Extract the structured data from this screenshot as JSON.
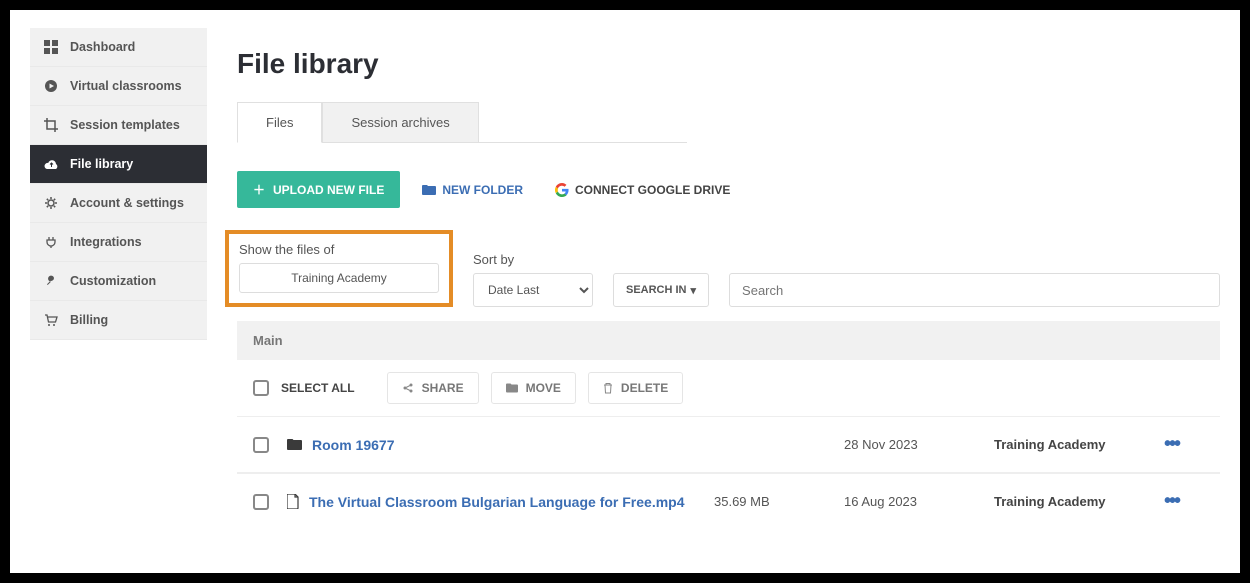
{
  "sidebar": {
    "items": [
      {
        "label": "Dashboard",
        "icon": "grid-icon"
      },
      {
        "label": "Virtual classrooms",
        "icon": "play-circle-icon"
      },
      {
        "label": "Session templates",
        "icon": "crop-icon"
      },
      {
        "label": "File library",
        "icon": "cloud-upload-icon",
        "active": true
      },
      {
        "label": "Account & settings",
        "icon": "gear-icon"
      },
      {
        "label": "Integrations",
        "icon": "plug-icon"
      },
      {
        "label": "Customization",
        "icon": "wrench-icon"
      },
      {
        "label": "Billing",
        "icon": "cart-icon"
      }
    ]
  },
  "page": {
    "title": "File library"
  },
  "tabs": [
    {
      "label": "Files",
      "active": true
    },
    {
      "label": "Session archives",
      "active": false
    }
  ],
  "actions": {
    "upload": "UPLOAD NEW FILE",
    "new_folder": "NEW FOLDER",
    "connect_drive": "CONNECT GOOGLE DRIVE"
  },
  "filters": {
    "show_label": "Show the files of",
    "show_value": "Training Academy",
    "sort_label": "Sort by",
    "sort_value": "Date Last",
    "search_in": "SEARCH IN",
    "search_placeholder": "Search"
  },
  "breadcrumb": "Main",
  "bulk": {
    "select_all": "SELECT ALL",
    "share": "SHARE",
    "move": "MOVE",
    "delete": "DELETE"
  },
  "rows": [
    {
      "type": "folder",
      "name": "Room 19677",
      "size": "",
      "date": "28 Nov 2023",
      "owner": "Training Academy"
    },
    {
      "type": "file",
      "name": "The Virtual Classroom Bulgarian Language for Free.mp4",
      "size": "35.69 MB",
      "date": "16 Aug 2023",
      "owner": "Training Academy"
    }
  ]
}
